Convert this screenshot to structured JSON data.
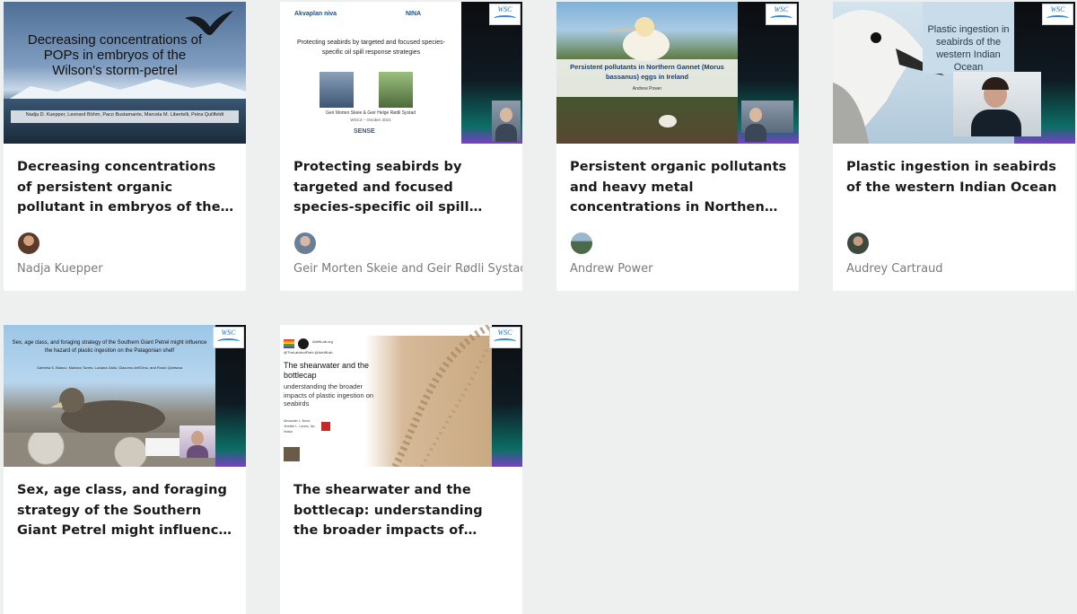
{
  "cards": [
    {
      "title": "Decreasing concentrations of persistent organic pollutant in embryos of the Wilson’s storm-petrel",
      "author": "Nadja Kuepper",
      "avatar_color": "#6b4a36",
      "slide": {
        "heading": "Decreasing concentrations of POPs in embryos of the Wilson's storm-petrel",
        "authors": "Nadja D. Kuepper, Leonard Böhm, Paco Bustamante, Marcela M. Libertelli, Petra Quillfeldt"
      }
    },
    {
      "title": "Protecting seabirds by targeted and focused species-specific oil spill response strategies",
      "author": "Geir Morten Skeie and Geir Rødli Systad",
      "avatar_color": "#7d8ba0",
      "slide": {
        "logo_left": "Akvaplan niva",
        "logo_right": "NINA",
        "heading": "Protecting seabirds by targeted and focused species-specific oil spill response strategies",
        "names": "Geir Morten Skeie & Geir Helge Rødli Systad",
        "event": "WSC3 – October 2021",
        "footer_logo": "SENSE"
      }
    },
    {
      "title": "Persistent organic pollutants and heavy metal concentrations in Northen Gannet (Morus bossanus) eggs in Ireland",
      "author": "Andrew Power",
      "avatar_color": "#4f6a5a",
      "slide": {
        "heading": "Persistent pollutants in Northern Gannet (Morus bassanus) eggs in Ireland",
        "presenter": "Andrew Power"
      }
    },
    {
      "title": "Plastic ingestion in seabirds of the western Indian Ocean",
      "author": "Audrey Cartraud",
      "avatar_color": "#5f7a68",
      "slide": {
        "heading": "Plastic ingestion in seabirds of the western Indian Ocean"
      }
    },
    {
      "title": "Sex, age class, and foraging strategy of the Southern Giant Petrel might influence the hazard of plastic ingestion on the Patagonian shelf",
      "author": "",
      "avatar_color": "#777777",
      "slide": {
        "heading": "Sex, age class, and foraging strategy of the Southern Giant Petrel might influence the hazard of plastic ingestion on the Patagonian shelf",
        "authors": "Gabriela S. Blanco, Mariano Torres, Luciana Gallo, Giacomo dell'Omo, and Flavio Quintana"
      }
    },
    {
      "title": "The shearwater and the bottlecap: understanding the broader impacts of plastic ingestion on seabirds",
      "author": "",
      "avatar_color": "#777777",
      "slide": {
        "handle": "AdriftLab.org",
        "twitter": "@TheLabAndField @AdriftLab",
        "heading": "The shearwater and the bottlecap",
        "subheading": "understanding the broader impacts of plastic ingestion on seabirds",
        "names": "Alexander L. Bond, Jennifer L. Lavers, Ian Hutton"
      }
    }
  ],
  "brand": {
    "wsc_label": "WSC",
    "accent_teal": "#0c6e66",
    "accent_purple": "#7a3fc4"
  }
}
